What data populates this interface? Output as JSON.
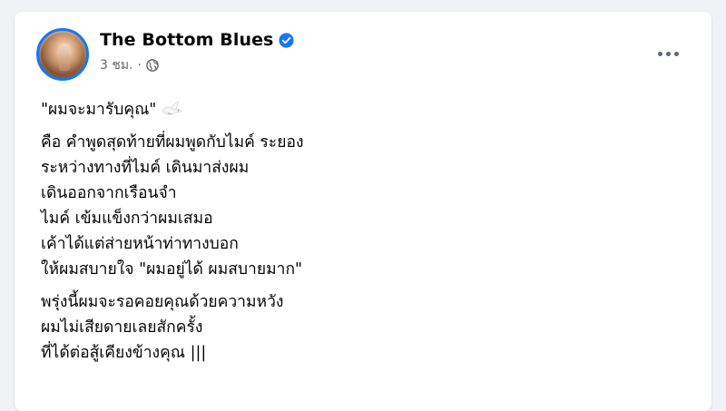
{
  "post": {
    "author": "The Bottom Blues",
    "timestamp": "3 ชม.",
    "separator": "·",
    "paragraphs": [
      {
        "lines": [
          "\"ผมจะมารับคุณ\""
        ],
        "emoji": "dove-emoji"
      },
      {
        "lines": [
          "คือ คำพูดสุดท้ายที่ผมพูดกับไมค์ ระยอง",
          "ระหว่างทางที่ไมค์ เดินมาส่งผม",
          "เดินออกจากเรือนจำ",
          "ไมค์ เข้มแข็งกว่าผมเสมอ",
          "เค้าได้แต่ส่ายหน้าท่าทางบอก",
          "ให้ผมสบายใจ \"ผมอยู่ได้ ผมสบายมาก\""
        ]
      },
      {
        "lines": [
          "พรุ่งนี้ผมจะรอคอยคุณด้วยความหวัง",
          "ผมไม่เสียดายเลยสักครั้ง",
          "ที่ได้ต่อสู้เคียงข้างคุณ |||"
        ]
      }
    ]
  },
  "icons": {
    "verified": "verified-badge-icon",
    "privacy": "globe-icon",
    "menu": "more-options-icon"
  },
  "colors": {
    "background": "#f0f2f5",
    "card": "#ffffff",
    "accent": "#1877f2",
    "secondary_text": "#65676b"
  }
}
